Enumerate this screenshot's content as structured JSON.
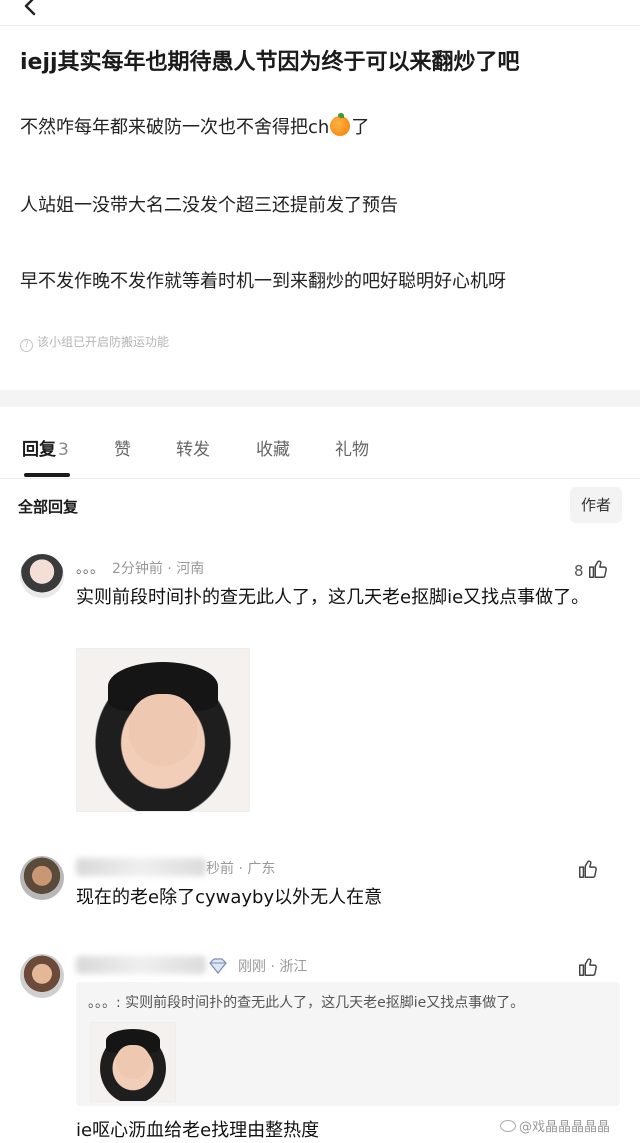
{
  "post": {
    "title": "iejj其实每年也期待愚人节因为终于可以来翻炒了吧",
    "line1_before": "不然咋每年都来破防一次也不舍得把ch",
    "line1_after": "了",
    "line2": "人站姐一没带大名二没发个超三还提前发了预告",
    "line3": "早不发作晚不发作就等着时机一到来翻炒的吧好聪明好心机呀",
    "notice": "该小组已开启防搬运功能"
  },
  "tabs": [
    {
      "label": "回复",
      "count": "3"
    },
    {
      "label": "赞"
    },
    {
      "label": "转发"
    },
    {
      "label": "收藏"
    },
    {
      "label": "礼物"
    }
  ],
  "filter": {
    "label": "全部回复",
    "author_button": "作者"
  },
  "comments": [
    {
      "name": "。。。",
      "time_location": "2分钟前 · 河南",
      "likes": "8",
      "text": "实则前段时间扑的查无此人了，这几天老e抠脚ie又找点事做了。"
    },
    {
      "time_location": "秒前 · 广东",
      "text": "现在的老e除了cywayby以外无人在意"
    },
    {
      "time_location": "刚刚 · 浙江",
      "quote": "。。。: 实则前段时间扑的查无此人了，这几天老e抠脚ie又找点事做了。",
      "text": "ie呕心沥血给老e找理由整热度"
    }
  ],
  "watermark": "@戏晶晶晶晶晶",
  "icons": {
    "back": "back-arrow-icon",
    "like": "thumbs-up-icon",
    "notice": "question-circle-icon",
    "badge": "diamond-badge-icon"
  }
}
